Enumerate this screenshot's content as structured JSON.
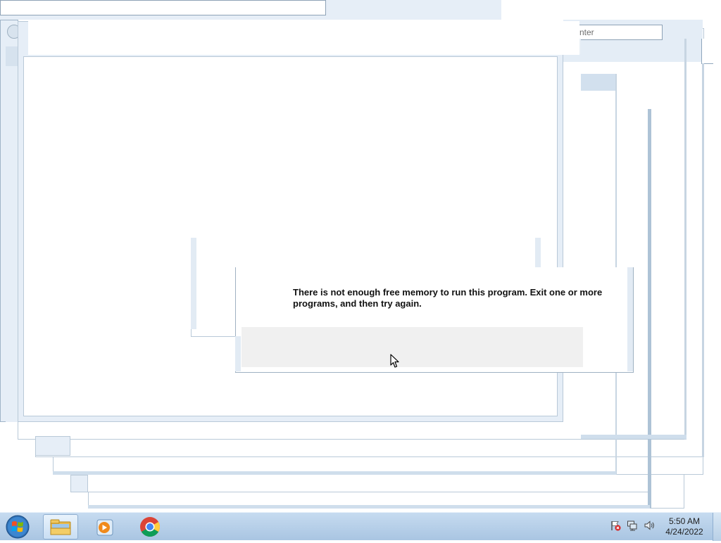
{
  "dialog": {
    "message": "There is not enough free memory to run this program. Exit one or more programs, and then try again."
  },
  "background_window": {
    "search_fragment": "nter"
  },
  "taskbar": {
    "start_icon": "windows-orb-icon",
    "pinned": [
      {
        "name": "file-explorer",
        "icon": "folder-icon",
        "active": true
      },
      {
        "name": "media-player",
        "icon": "media-player-icon",
        "active": false
      },
      {
        "name": "chrome",
        "icon": "chrome-icon",
        "active": false
      }
    ],
    "tray_icons": [
      "action-center-flag-icon",
      "network-icon",
      "volume-icon"
    ],
    "clock": {
      "time": "5:50 AM",
      "date": "4/24/2022"
    }
  },
  "colors": {
    "taskbar": "#b8d0e8",
    "window_frame": "#e4edf6",
    "window_border": "#8fa6bd"
  }
}
